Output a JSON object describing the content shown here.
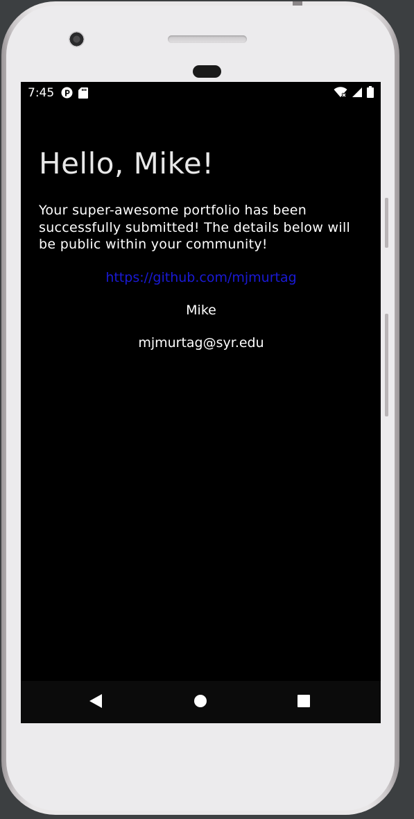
{
  "status_bar": {
    "time": "7:45",
    "left_icons": [
      "app-notification-icon",
      "sd-card-icon"
    ],
    "right_icons": [
      "wifi-icon",
      "cell-signal-icon",
      "battery-icon"
    ]
  },
  "main": {
    "greeting": "Hello, Mike!",
    "message": "Your super-awesome portfolio has been successfully submitted! The details below will be public within your community!",
    "github_link": "https://github.com/mjmurtag",
    "name": "Mike",
    "email": "mjmurtag@syr.edu"
  },
  "nav_bar": {
    "buttons": [
      "back-icon",
      "home-icon",
      "recents-icon"
    ]
  },
  "colors": {
    "screen_background": "#000000",
    "text": "#ffffff",
    "link": "#1a1ad6",
    "nav_background": "#0b0b0b"
  }
}
